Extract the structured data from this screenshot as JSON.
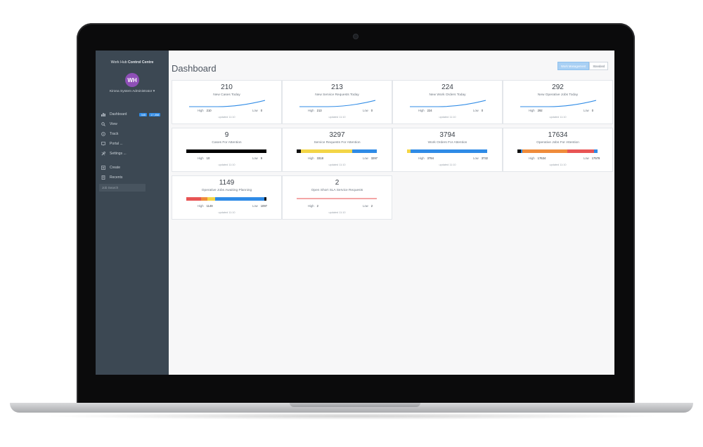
{
  "sidebar": {
    "brand_prefix": "Work Hub",
    "brand_bold": "Control Centre",
    "avatar_initials": "WH",
    "user": "Kirona System Administrator",
    "items": [
      {
        "label": "Dashboard",
        "icon": "bar-chart-icon",
        "badges": [
          "345",
          "17,358"
        ]
      },
      {
        "label": "View",
        "icon": "search-icon"
      },
      {
        "label": "Track",
        "icon": "compass-icon"
      },
      {
        "label": "Portal ...",
        "icon": "monitor-icon"
      },
      {
        "label": "Settings ...",
        "icon": "wrench-icon"
      },
      {
        "label": "Create",
        "icon": "plus-square-icon"
      },
      {
        "label": "Recents",
        "icon": "document-icon"
      }
    ],
    "job_search_placeholder": "Job Search"
  },
  "main": {
    "title": "Dashboard",
    "toggle": [
      "Work Management",
      "Standard"
    ],
    "cards": [
      {
        "value": "210",
        "label": "New Cases Today",
        "high": "210",
        "low": "0",
        "updated": "updated 11:10",
        "viz": "spark"
      },
      {
        "value": "213",
        "label": "New Service Requests Today",
        "high": "213",
        "low": "0",
        "updated": "updated 11:10",
        "viz": "spark"
      },
      {
        "value": "224",
        "label": "New Work Orders Today",
        "high": "224",
        "low": "0",
        "updated": "updated 11:10",
        "viz": "spark"
      },
      {
        "value": "292",
        "label": "New Operative Jobs Today",
        "high": "292",
        "low": "0",
        "updated": "updated 11:10",
        "viz": "spark"
      },
      {
        "value": "9",
        "label": "Cases For Attention",
        "high": "10",
        "low": "9",
        "updated": "updated 11:10",
        "viz": "bar",
        "segments": [
          {
            "color": "#000000",
            "pct": 100
          }
        ]
      },
      {
        "value": "3297",
        "label": "Service Requests For Attention",
        "high": "3318",
        "low": "3297",
        "updated": "updated 11:10",
        "viz": "bar",
        "segments": [
          {
            "color": "#111111",
            "pct": 5
          },
          {
            "color": "#f3d547",
            "pct": 64
          },
          {
            "color": "#2f8be6",
            "pct": 31
          }
        ]
      },
      {
        "value": "3794",
        "label": "Work Orders For Attention",
        "high": "3794",
        "low": "3732",
        "updated": "updated 11:10",
        "viz": "bar",
        "segments": [
          {
            "color": "#f3d547",
            "pct": 4
          },
          {
            "color": "#2f8be6",
            "pct": 96
          }
        ]
      },
      {
        "value": "17634",
        "label": "Operative Jobs For Attention",
        "high": "17634",
        "low": "17578",
        "updated": "updated 11:10",
        "viz": "bar",
        "segments": [
          {
            "color": "#111111",
            "pct": 4
          },
          {
            "color": "#2f8be6",
            "pct": 2
          },
          {
            "color": "#ef8c3b",
            "pct": 56
          },
          {
            "color": "#e85454",
            "pct": 34
          },
          {
            "color": "#2f8be6",
            "pct": 4
          }
        ]
      },
      {
        "value": "1149",
        "label": "Operative Jobs Awaiting Planning",
        "high": "1149",
        "low": "1097",
        "updated": "updated 11:10",
        "viz": "bar",
        "segments": [
          {
            "color": "#e85454",
            "pct": 18
          },
          {
            "color": "#ef8c3b",
            "pct": 8
          },
          {
            "color": "#f3d547",
            "pct": 10
          },
          {
            "color": "#2f8be6",
            "pct": 61
          },
          {
            "color": "#111111",
            "pct": 3
          }
        ]
      },
      {
        "value": "2",
        "label": "Open Short SLA Service Requests",
        "high": "2",
        "low": "2",
        "updated": "updated 11:10",
        "viz": "bar",
        "segments": [
          {
            "color": "#f4a6a6",
            "pct": 100
          }
        ]
      }
    ]
  },
  "colors": {
    "accent": "#2f8be6",
    "sidebar": "#3c4853",
    "avatar": "#8e4fb7"
  }
}
